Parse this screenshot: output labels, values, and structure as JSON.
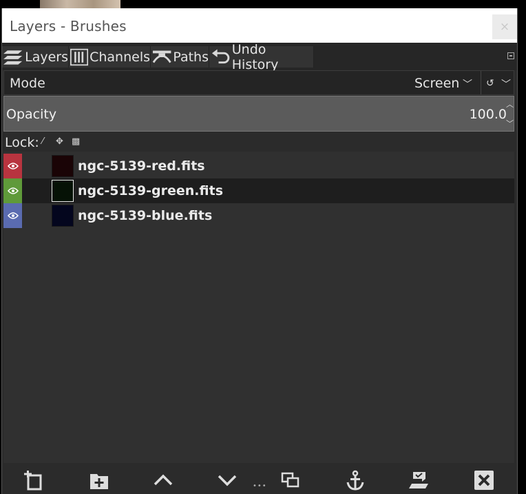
{
  "window": {
    "title": "Layers - Brushes",
    "close_glyph": "×"
  },
  "tabs": [
    {
      "label": "Layers",
      "icon": "layers-icon"
    },
    {
      "label": "Channels",
      "icon": "channels-icon"
    },
    {
      "label": "Paths",
      "icon": "paths-icon"
    },
    {
      "label": "Undo History",
      "icon": "undo-history-icon"
    }
  ],
  "mode": {
    "label": "Mode",
    "value": "Screen"
  },
  "opacity": {
    "label": "Opacity",
    "value": "100.0"
  },
  "lock": {
    "label": "Lock:"
  },
  "layers": [
    {
      "name": "ngc-5139-red.fits",
      "eye_color": "#b8343f",
      "thumb_color": "#1a0406",
      "selected": false
    },
    {
      "name": "ngc-5139-green.fits",
      "eye_color": "#5f9a3a",
      "thumb_color": "#061206",
      "selected": true
    },
    {
      "name": "ngc-5139-blue.fits",
      "eye_color": "#5a6bb0",
      "thumb_color": "#04061e",
      "selected": false
    }
  ],
  "toolbar": [
    "new-layer-icon",
    "new-layer-group-icon",
    "raise-layer-icon",
    "lower-layer-icon",
    "duplicate-layer-icon",
    "anchor-layer-icon",
    "merge-layer-icon",
    "delete-layer-icon"
  ]
}
